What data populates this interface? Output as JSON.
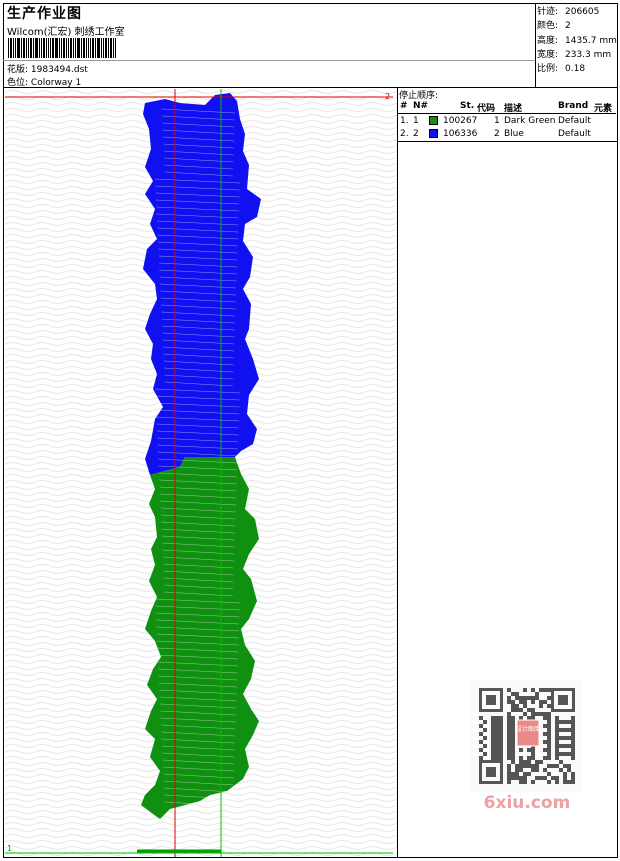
{
  "header": {
    "title": "生产作业图",
    "company": "Wilcom(汇宏) 刺绣工作室",
    "design_label": "花版:",
    "design_value": "1983494.dst",
    "colorway_label": "色位:",
    "colorway_value": "Colorway 1"
  },
  "stats": [
    {
      "label": "针迹:",
      "value": "206605"
    },
    {
      "label": "颜色:",
      "value": "2"
    },
    {
      "label": "高度:",
      "value": "1435.7 mm"
    },
    {
      "label": "宽度:",
      "value": "233.3 mm"
    },
    {
      "label": "比例:",
      "value": "0.18"
    }
  ],
  "stop_sequence": {
    "title": "停止顺序:",
    "headers": [
      "#",
      "N#",
      "St.",
      "代码",
      "描述",
      "Brand",
      "元素"
    ],
    "rows": [
      {
        "idx": "1.",
        "n": "1",
        "color": "#109010",
        "stitches": "100267",
        "code": "1",
        "desc": "Dark Green",
        "brand": "Default"
      },
      {
        "idx": "2.",
        "n": "2",
        "color": "#1010f0",
        "stitches": "106336",
        "code": "2",
        "desc": "Blue",
        "brand": "Default"
      }
    ]
  },
  "canvas": {
    "corner_mark": "2",
    "bottom_mark": "1"
  },
  "watermark": {
    "text": "6xiu.com",
    "stamp": "设计图库"
  }
}
